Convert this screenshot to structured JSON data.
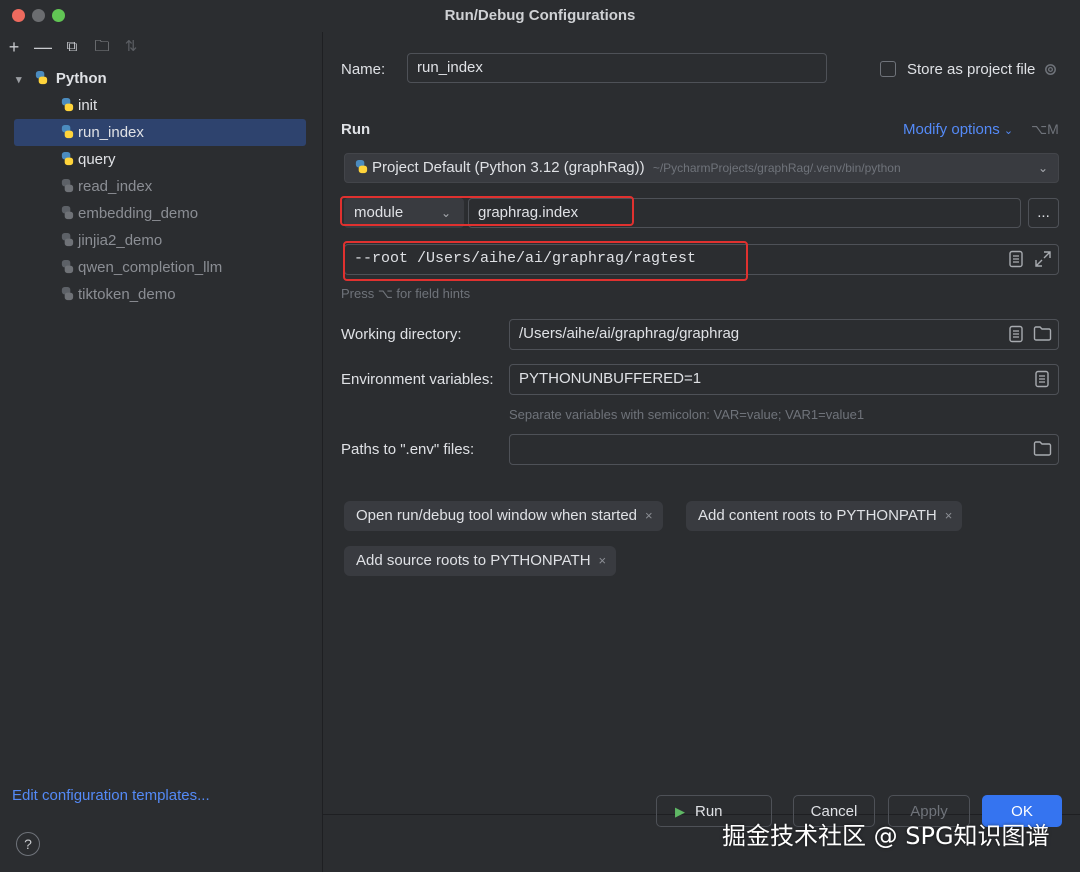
{
  "window": {
    "title": "Run/Debug Configurations"
  },
  "toolbar": {
    "add": "+",
    "remove": "—",
    "copy": "⧉",
    "folder": "🗀",
    "sort": "⇅"
  },
  "tree": {
    "root_label": "Python",
    "items": [
      {
        "label": "init"
      },
      {
        "label": "run_index"
      },
      {
        "label": "query"
      },
      {
        "label": "read_index"
      },
      {
        "label": "embedding_demo"
      },
      {
        "label": "jinjia2_demo"
      },
      {
        "label": "qwen_completion_llm"
      },
      {
        "label": "tiktoken_demo"
      }
    ],
    "edit_templates": "Edit configuration templates..."
  },
  "form": {
    "name_label": "Name:",
    "name_value": "run_index",
    "store_label": "Store as project file",
    "run_section": "Run",
    "modify_options": "Modify options",
    "modify_shortcut": "⌥M",
    "interpreter": "Project Default (Python 3.12 (graphRag))",
    "interpreter_path": "~/PycharmProjects/graphRag/.venv/bin/python",
    "run_type": "module",
    "module_value": "graphrag.index",
    "more_btn": "...",
    "params_value": "--root /Users/aihe/ai/graphrag/ragtest",
    "field_hint": "Press ⌥ for field hints",
    "workdir_label": "Working directory:",
    "workdir_value": "/Users/aihe/ai/graphrag/graphrag",
    "env_label": "Environment variables:",
    "env_value": "PYTHONUNBUFFERED=1",
    "env_hint": "Separate variables with semicolon: VAR=value; VAR1=value1",
    "dotenv_label": "Paths to \".env\" files:",
    "dotenv_value": ""
  },
  "chips": [
    {
      "label": "Open run/debug tool window when started"
    },
    {
      "label": "Add content roots to PYTHONPATH"
    },
    {
      "label": "Add source roots to PYTHONPATH"
    }
  ],
  "chip_close": "×",
  "buttons": {
    "help": "?",
    "run": "Run",
    "cancel": "Cancel",
    "apply": "Apply",
    "ok": "OK"
  },
  "watermark": "掘金技术社区 @ SPG知识图谱"
}
